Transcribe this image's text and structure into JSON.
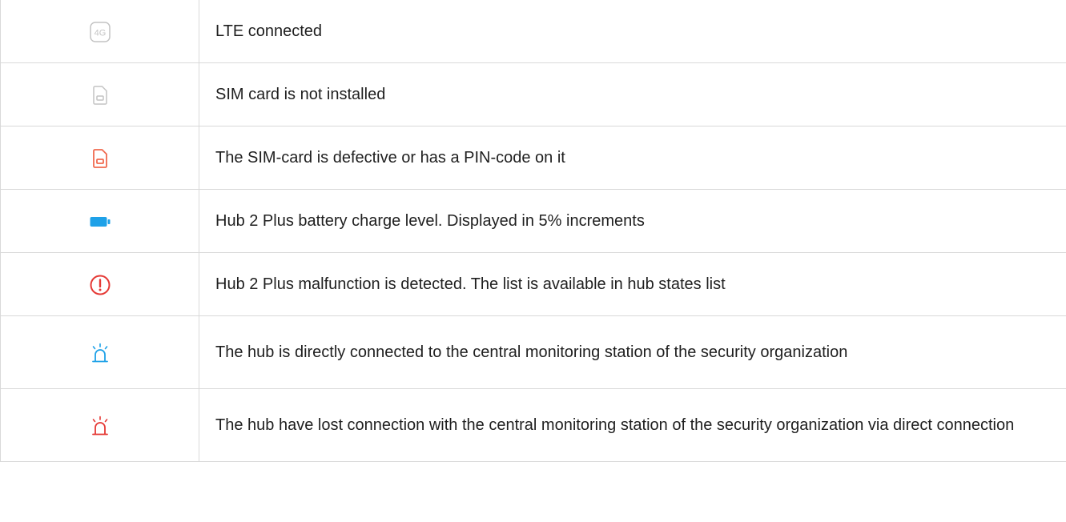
{
  "rows": [
    {
      "icon": "4g-lte-icon",
      "color": "#c4c4c4",
      "text": "LTE connected",
      "icon_label": "4G"
    },
    {
      "icon": "sim-card-missing-icon",
      "color": "#c4c4c4",
      "text": "SIM card is not installed"
    },
    {
      "icon": "sim-card-error-icon",
      "color": "#f06a4f",
      "text": "The SIM-card is defective or has a PIN-code on it"
    },
    {
      "icon": "battery-icon",
      "color": "#1ea1e8",
      "text": "Hub 2 Plus battery charge level. Displayed in 5% increments"
    },
    {
      "icon": "malfunction-alert-icon",
      "color": "#e53935",
      "text": "Hub 2 Plus malfunction is detected. The list is available in hub states list"
    },
    {
      "icon": "siren-connected-icon",
      "color": "#1ea1e8",
      "text": "The hub is directly connected to the central monitoring station of the security organization"
    },
    {
      "icon": "siren-disconnected-icon",
      "color": "#e53935",
      "text": "The hub have lost connection with the central monitoring station of the security organization via direct connection"
    }
  ]
}
